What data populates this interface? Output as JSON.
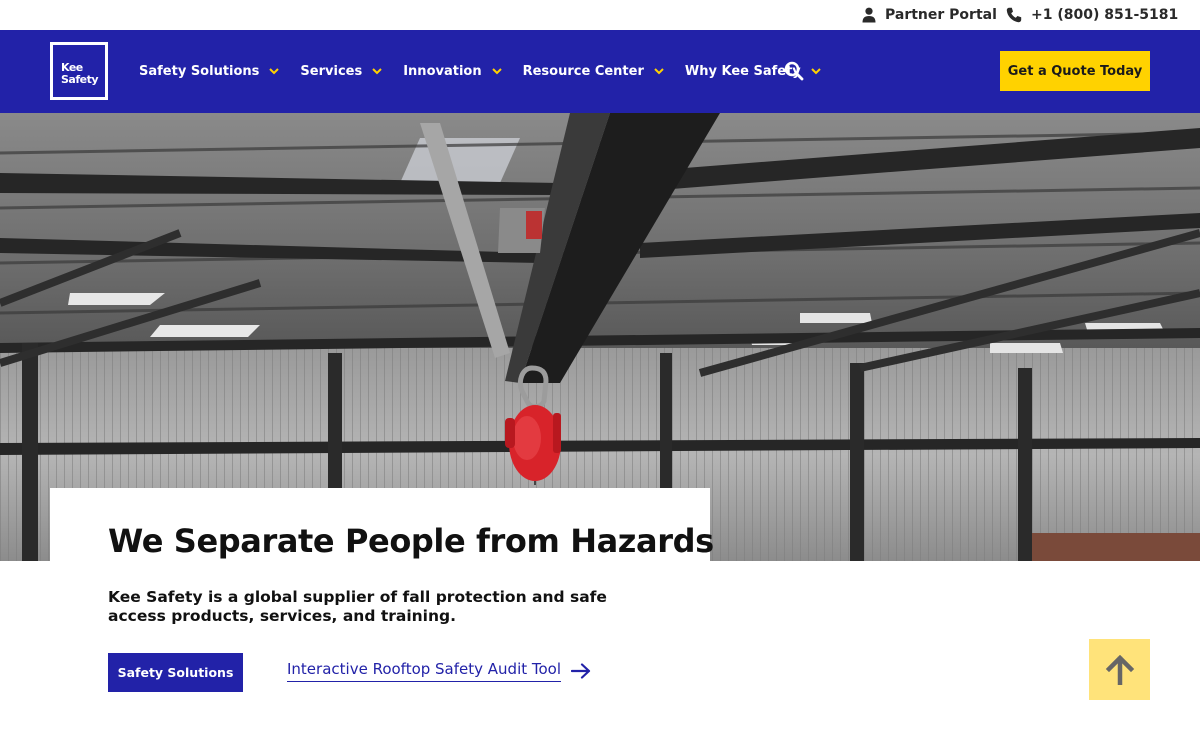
{
  "utility_bar": {
    "partner_portal": "Partner Portal",
    "phone": "+1 (800) 851-5181"
  },
  "brand": {
    "name_line1": "Kee",
    "name_line2": "Safety"
  },
  "nav": {
    "items": [
      {
        "label": "Safety Solutions"
      },
      {
        "label": "Services"
      },
      {
        "label": "Innovation"
      },
      {
        "label": "Resource Center"
      },
      {
        "label": "Why Kee Safety"
      }
    ],
    "cta_label": "Get a Quote Today"
  },
  "hero": {
    "headline": "We Separate People from Hazards",
    "subtext": "Kee Safety is a global supplier of fall protection and safe access products, services, and training.",
    "primary_button": "Safety Solutions",
    "secondary_link": "Interactive Rooftop Safety Audit Tool"
  },
  "colors": {
    "brand_blue": "#2222a8",
    "accent_yellow": "#ffd200",
    "back_to_top_bg": "#ffe37a",
    "device_red": "#d8232a"
  },
  "icons": {
    "partner_portal": "user-icon",
    "phone": "phone-icon",
    "nav_dropdown": "chevron-down-icon",
    "search": "search-icon",
    "link_arrow": "arrow-right-icon",
    "back_to_top": "arrow-up-icon"
  }
}
